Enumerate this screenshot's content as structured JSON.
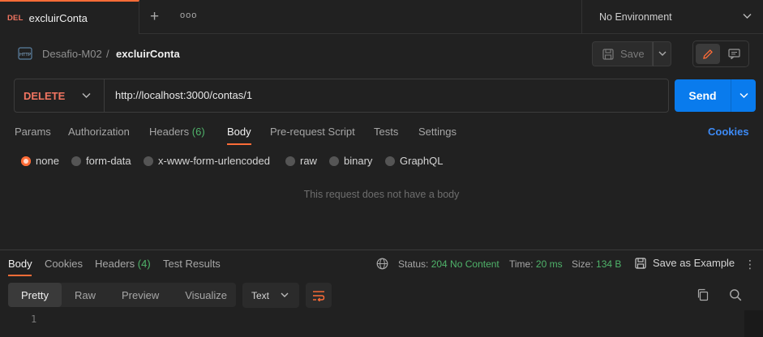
{
  "tab": {
    "method": "DEL",
    "title": "excluirConta"
  },
  "environment": {
    "label": "No Environment"
  },
  "breadcrumb": {
    "parent": "Desafio-M02",
    "separator": "/",
    "current": "excluirConta"
  },
  "toolbar": {
    "save_label": "Save"
  },
  "request": {
    "method": "DELETE",
    "url": "http://localhost:3000/contas/1",
    "send_label": "Send",
    "tabs": [
      {
        "label": "Params"
      },
      {
        "label": "Authorization"
      },
      {
        "label": "Headers",
        "count": "(6)"
      },
      {
        "label": "Body"
      },
      {
        "label": "Pre-request Script"
      },
      {
        "label": "Tests"
      },
      {
        "label": "Settings"
      }
    ],
    "cookies_link": "Cookies",
    "body_types": [
      "none",
      "form-data",
      "x-www-form-urlencoded",
      "raw",
      "binary",
      "GraphQL"
    ],
    "selected_body_type": "none",
    "empty_message": "This request does not have a body"
  },
  "response": {
    "tabs": [
      {
        "label": "Body"
      },
      {
        "label": "Cookies"
      },
      {
        "label": "Headers",
        "count": "(4)"
      },
      {
        "label": "Test Results"
      }
    ],
    "status_label": "Status:",
    "status_value": "204 No Content",
    "time_label": "Time:",
    "time_value": "20 ms",
    "size_label": "Size:",
    "size_value": "134 B",
    "save_example": "Save as Example",
    "formats": [
      "Pretty",
      "Raw",
      "Preview",
      "Visualize"
    ],
    "language": "Text",
    "line_number": "1"
  },
  "colors": {
    "accent": "#ff6c37",
    "send": "#097bed",
    "success": "#4fb36a",
    "delete": "#f27561"
  }
}
